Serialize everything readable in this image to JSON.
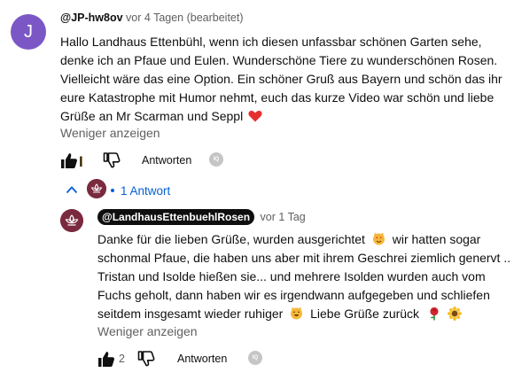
{
  "comment": {
    "avatar_letter": "J",
    "author": "@JP-hw8ov",
    "time": "vor 4 Tagen (bearbeitet)",
    "text_lines": [
      "Hallo Landhaus Ettenbühl, wenn ich diesen unfassbar schönen Garten sehe,",
      "denke ich an Pfaue und Eulen. Wunderschöne Tiere zu wunderschönen Rosen.",
      "Vielleicht wäre das eine Option. Ein schöner Gruß aus Bayern und schön das ihr",
      "eure Katastrophe mit Humor nehmt, euch das kurze Video war schön und liebe",
      "Grüße an Mr Scarman und Seppl"
    ],
    "show_less": "Weniger anzeigen",
    "reply_label": "Antworten",
    "heart_color": "#e62e2e"
  },
  "replies_toggle": {
    "count_label": "1 Antwort"
  },
  "reply": {
    "author": "@LandhausEttenbuehlRosen",
    "time": "vor 1 Tag",
    "text_lines": [
      "Danke für die lieben Grüße, wurden ausgerichtet",
      "wir hatten sogar",
      "schonmal Pfaue, die haben uns aber mit ihrem Geschrei ziemlich genervt ..",
      "Tristan und Isolde hießen sie... und mehrere Isolden wurden auch vom",
      "Fuchs geholt, dann haben wir es irgendwann aufgegeben und schliefen",
      "seitdem insgesamt wieder ruhiger",
      "Liebe Grüße zurück"
    ],
    "show_less": "Weniger anzeigen",
    "like_count": "2",
    "reply_label": "Antworten"
  },
  "colors": {
    "link_blue": "#065fd4",
    "avatar_purple": "#7b57c6",
    "channel_maroon": "#7a2a3e"
  }
}
